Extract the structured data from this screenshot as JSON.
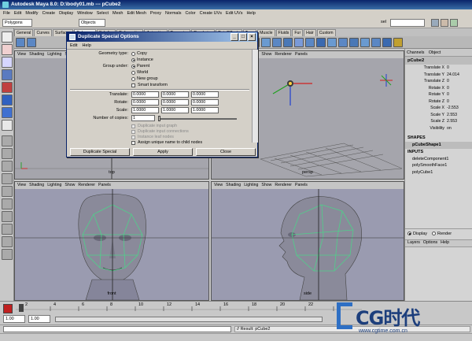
{
  "window": {
    "title": "Autodesk Maya 8.0: D:\\body01.mb   ---   pCube2"
  },
  "menubar": [
    "File",
    "Edit",
    "Modify",
    "Create",
    "Display",
    "Window",
    "Select",
    "Mesh",
    "Edit Mesh",
    "Proxy",
    "Normals",
    "Color",
    "Create UVs",
    "Edit UVs",
    "Help"
  ],
  "statusline": {
    "mode": "Polygons",
    "selection_mode": "Objects",
    "sel_label": "sel"
  },
  "shelf_tabs": [
    "General",
    "Curves",
    "Surfaces",
    "Polygons",
    "Subdivs",
    "Deformation",
    "Animation",
    "Dynamics",
    "Rendering",
    "PaintEffects",
    "Toon",
    "Muscle",
    "Fluids",
    "Fur",
    "Hair",
    "Custom"
  ],
  "dialog": {
    "title": "Duplicate Special Options",
    "menu": [
      "Edit",
      "Help"
    ],
    "geometry_type_label": "Geometry type:",
    "geometry_options": [
      "Copy",
      "Instance"
    ],
    "geometry_selected": 1,
    "group_under_label": "Group under:",
    "group_options": [
      "Parent",
      "World",
      "New group"
    ],
    "group_selected": 0,
    "smart_transform": "Smart transform",
    "translate_label": "Translate:",
    "translate": [
      "0.0000",
      "0.0000",
      "0.0000"
    ],
    "rotate_label": "Rotate:",
    "rotate": [
      "0.0000",
      "0.0000",
      "0.0000"
    ],
    "scale_label": "Scale:",
    "scale": [
      "1.0000",
      "1.0000",
      "1.0000"
    ],
    "copies_label": "Number of copies:",
    "copies": "1",
    "disabled_options": [
      "Duplicate input graph",
      "Duplicate input connections",
      "Instance leaf nodes"
    ],
    "assign_unique": "Assign unique name to child nodes",
    "buttons": {
      "duplicate": "Duplicate Special",
      "apply": "Apply",
      "close": "Close"
    }
  },
  "viewports": {
    "menu": [
      "View",
      "Shading",
      "Lighting",
      "Show",
      "Renderer",
      "Panels"
    ],
    "labels": [
      "top",
      "persp",
      "front",
      "side"
    ]
  },
  "channel_box": {
    "header": [
      "Channels",
      "Object"
    ],
    "object": "pCube2",
    "attributes": [
      {
        "name": "Translate X",
        "value": "0"
      },
      {
        "name": "Translate Y",
        "value": "24.014"
      },
      {
        "name": "Translate Z",
        "value": "0"
      },
      {
        "name": "Rotate X",
        "value": "0"
      },
      {
        "name": "Rotate Y",
        "value": "0"
      },
      {
        "name": "Rotate Z",
        "value": "0"
      },
      {
        "name": "Scale X",
        "value": "-2.553"
      },
      {
        "name": "Scale Y",
        "value": "2.553"
      },
      {
        "name": "Scale Z",
        "value": "2.553"
      },
      {
        "name": "Visibility",
        "value": "on"
      }
    ],
    "shapes_label": "SHAPES",
    "shape": "pCubeShape1",
    "inputs_label": "INPUTS",
    "inputs": [
      "deleteComponent1",
      "polySmoothFace1",
      "polyCube1"
    ],
    "display_tabs": [
      "Display",
      "Render"
    ],
    "layer_menu": [
      "Layers",
      "Options",
      "Help"
    ]
  },
  "timeline": {
    "ticks": [
      "2",
      "4",
      "6",
      "8",
      "10",
      "12",
      "14",
      "16",
      "18",
      "20",
      "22",
      "24"
    ],
    "start": "1.00",
    "start2": "1.00"
  },
  "command_line": "// Result: pCube2",
  "watermark": {
    "brand": "CG时代",
    "url": "www.cgtime.com.cn"
  },
  "colors": {
    "title_blue": "#0a246a",
    "viewport_gray": "#a5a5ac",
    "wireframe_green": "#4fd08a"
  }
}
